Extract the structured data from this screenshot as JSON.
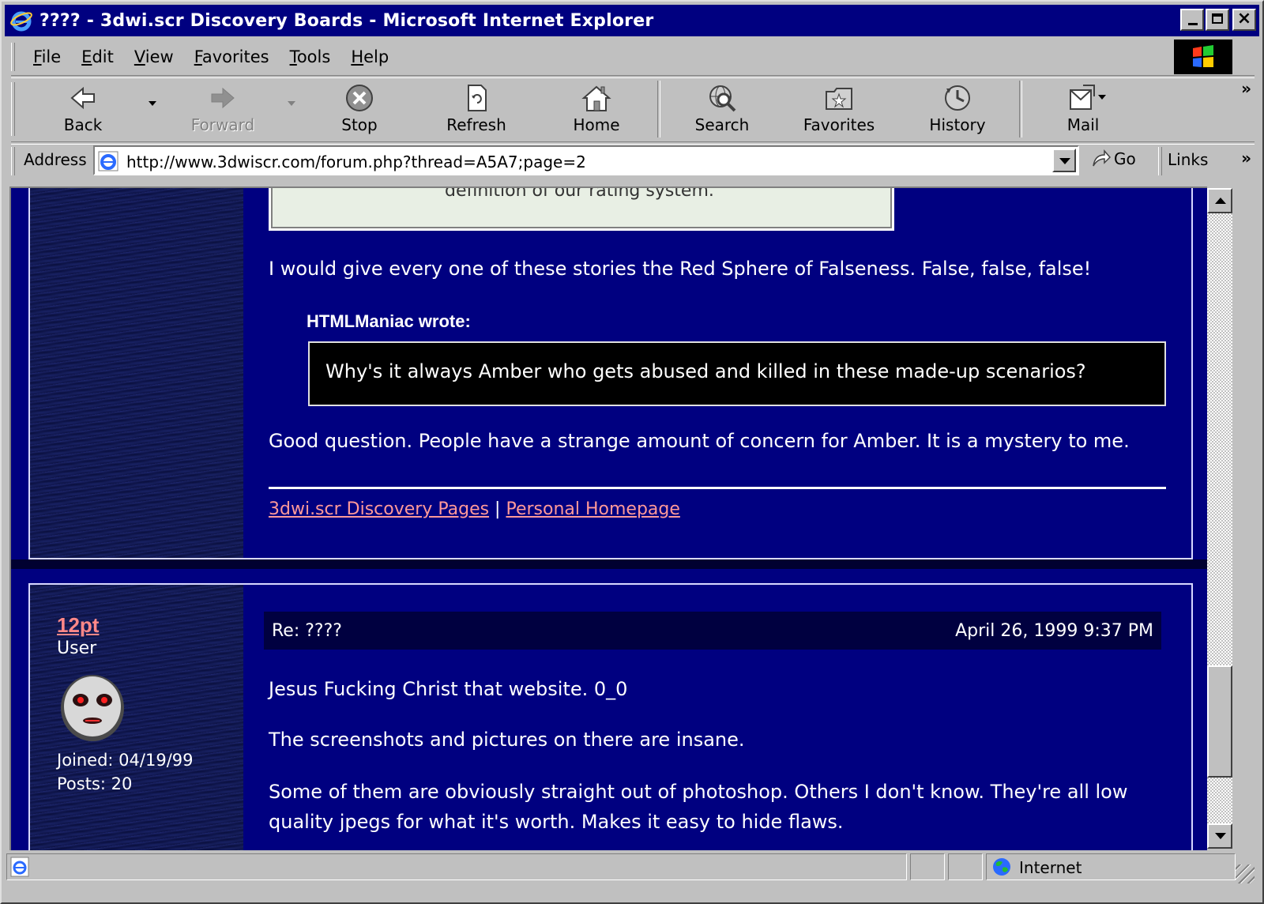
{
  "window": {
    "title": "???? - 3dwi.scr Discovery Boards - Microsoft Internet Explorer"
  },
  "menu": [
    "File",
    "Edit",
    "View",
    "Favorites",
    "Tools",
    "Help"
  ],
  "toolbar": {
    "back": "Back",
    "forward": "Forward",
    "stop": "Stop",
    "refresh": "Refresh",
    "home": "Home",
    "search": "Search",
    "favorites": "Favorites",
    "history": "History",
    "mail": "Mail"
  },
  "address": {
    "label": "Address",
    "url": "http://www.3dwiscr.com/forum.php?thread=A5A7;page=2",
    "go": "Go",
    "links": "Links"
  },
  "post1": {
    "top_quote_fragment": "definition of our rating system.",
    "text1": "I would give every one of these stories the Red Sphere of Falseness. False, false, false!",
    "quote_author": "HTMLManiac wrote:",
    "quote_text": "Why's it always Amber who gets abused and killed in these made-up scenarios?",
    "text2": "Good question. People have a strange amount of concern for Amber. It is a mystery to me.",
    "sig_link1": "3dwi.scr Discovery Pages",
    "sig_sep": " | ",
    "sig_link2": "Personal Homepage"
  },
  "post2": {
    "username": "12pt",
    "role": "User",
    "joined": "Joined: 04/19/99",
    "posts": "Posts: 20",
    "subject": "Re: ????",
    "date": "April 26, 1999 9:37 PM",
    "para1": "Jesus Fucking Christ that website. 0_0",
    "para2": "The screenshots and pictures on there are insane.",
    "para3_line1": "Some of them are obviously straight out of photoshop. Others I don't know. They're all low",
    "para3_line2": "quality jpegs for what it's worth. Makes it easy to hide flaws."
  },
  "status": {
    "zone": "Internet"
  },
  "colors": {
    "page_bg": "#000080",
    "link": "#ff9999",
    "titlebar": "#000080",
    "chrome": "#c0c0c0"
  }
}
